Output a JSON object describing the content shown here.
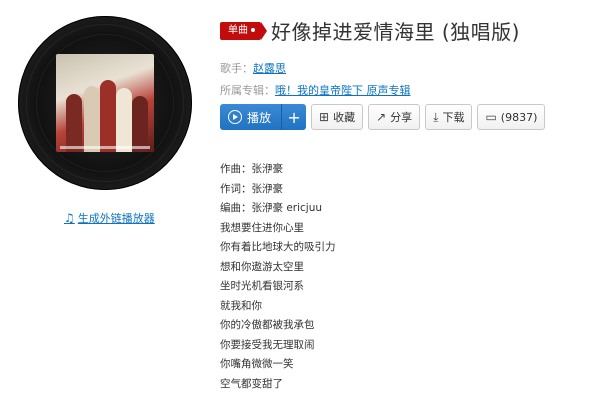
{
  "song": {
    "badge": "单曲",
    "title": "好像掉进爱情海里 (独唱版)",
    "singer_label": "歌手：",
    "singer": "赵露思",
    "album_label": "所属专辑：",
    "album": "哦！我的皇帝陛下 原声专辑"
  },
  "actions": {
    "play": "播放",
    "add": "+",
    "collect": "收藏",
    "share": "分享",
    "download": "下载",
    "comments": "(9837)"
  },
  "external_player": "生成外链播放器",
  "lyrics": [
    "作曲：张洢豪",
    "作词：张洢豪",
    "编曲：张洢豪 ericjuu",
    "我想要住进你心里",
    "你有着比地球大的吸引力",
    "想和你遨游太空里",
    "坐时光机看银河系",
    "就我和你",
    "你的冷傲都被我承包",
    "你要接受我无理取闹",
    "你嘴角微微一笑",
    "空气都变甜了"
  ],
  "icons": {
    "collect": "folder-plus-icon",
    "share": "share-icon",
    "download": "download-icon",
    "comment": "comment-icon",
    "note": "music-note-icon"
  }
}
